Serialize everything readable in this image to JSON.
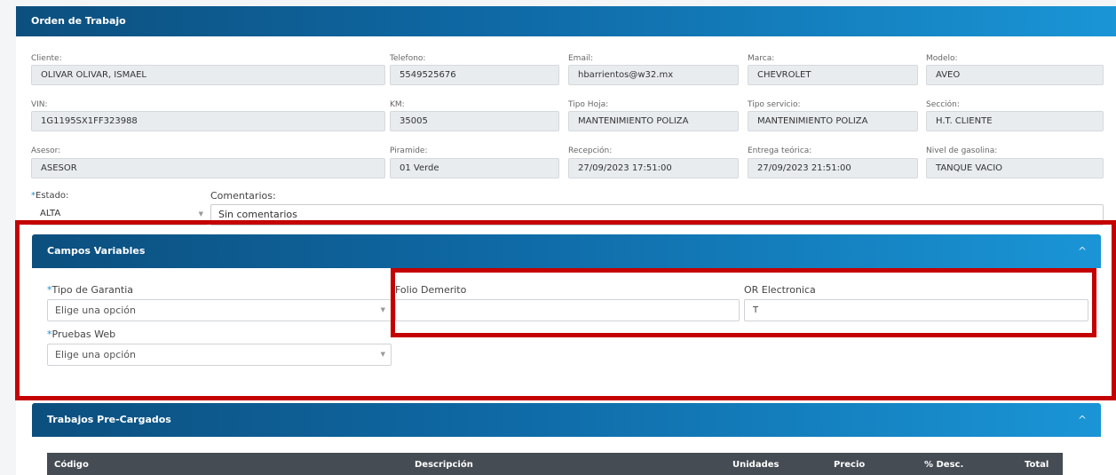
{
  "card_title": "Orden de Trabajo",
  "fields": {
    "cliente": {
      "label": "Cliente:",
      "value": "OLIVAR OLIVAR, ISMAEL"
    },
    "telefono": {
      "label": "Telefono:",
      "value": "5549525676"
    },
    "email": {
      "label": "Email:",
      "value": "hbarrientos@w32.mx"
    },
    "marca": {
      "label": "Marca:",
      "value": "CHEVROLET"
    },
    "modelo": {
      "label": "Modelo:",
      "value": "AVEO"
    },
    "vin": {
      "label": "VIN:",
      "value": "1G1195SX1FF323988"
    },
    "km": {
      "label": "KM:",
      "value": "35005"
    },
    "tipo_hoja": {
      "label": "Tipo Hoja:",
      "value": "MANTENIMIENTO POLIZA"
    },
    "tipo_servicio": {
      "label": "Tipo servicio:",
      "value": "MANTENIMIENTO POLIZA"
    },
    "seccion": {
      "label": "Sección:",
      "value": "H.T. CLIENTE"
    },
    "asesor": {
      "label": "Asesor:",
      "value": "ASESOR"
    },
    "piramide": {
      "label": "Piramide:",
      "value": "01 Verde"
    },
    "recepcion": {
      "label": "Recepción:",
      "value": "27/09/2023 17:51:00"
    },
    "entrega": {
      "label": "Entrega teórica:",
      "value": "27/09/2023 21:51:00"
    },
    "gasolina": {
      "label": "Nivel de gasolina:",
      "value": "TANQUE VACIO"
    }
  },
  "estado": {
    "required_mark": "*",
    "label": "Estado:",
    "value": "ALTA"
  },
  "comentarios": {
    "label": "Comentarios:",
    "value": "Sin comentarios"
  },
  "campos_variables": {
    "title": "Campos Variables",
    "chevron": "^",
    "tipo_garantia": {
      "required_mark": "*",
      "label": "Tipo de Garantia",
      "placeholder": "Elige una opción"
    },
    "pruebas_web": {
      "required_mark": "*",
      "label": "Pruebas Web",
      "placeholder": "Elige una opción"
    },
    "folio_demerito": {
      "label": "Folio Demerito",
      "value": ""
    },
    "or_electronica": {
      "label": "OR Electronica",
      "value": "T"
    }
  },
  "trabajos": {
    "title": "Trabajos Pre-Cargados",
    "chevron": "^",
    "columns": [
      "Código",
      "Descripción",
      "Unidades",
      "Precio",
      "% Desc.",
      "Total"
    ]
  },
  "colors": {
    "accent": "#1a8fd8",
    "highlight": "#c40000",
    "header_dark": "#0c4f7e",
    "table_head": "#454c54"
  },
  "icons": {
    "select_caret": "caret-down-icon",
    "collapse": "chevron-up-icon"
  }
}
